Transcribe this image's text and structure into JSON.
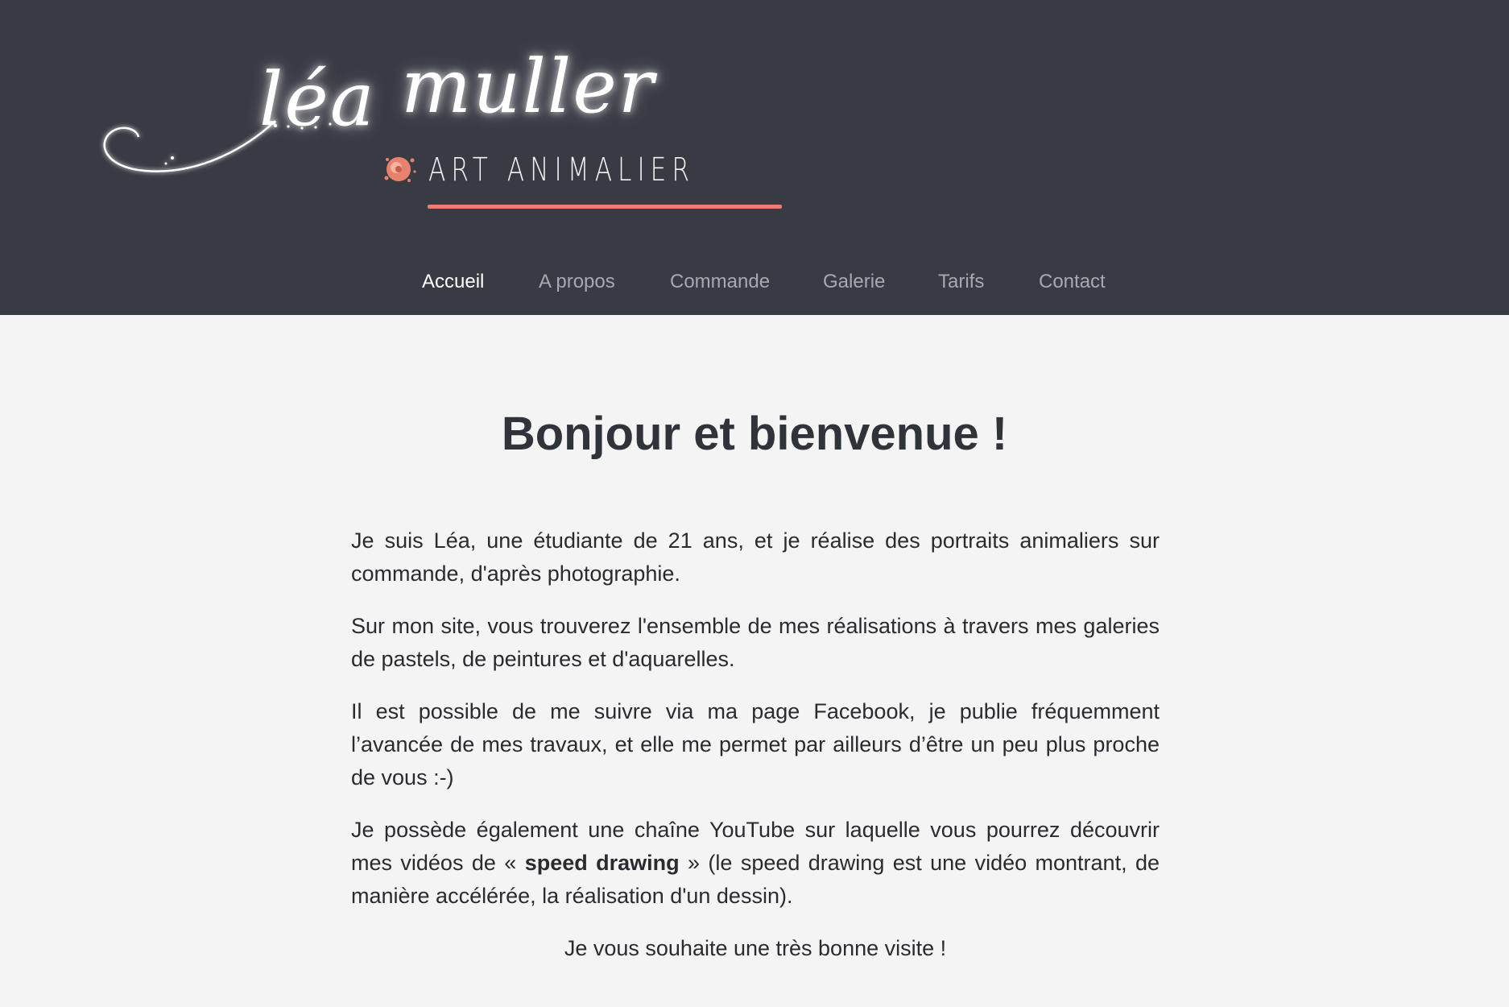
{
  "header": {
    "logo": {
      "first_name": "léa",
      "last_name": "muller",
      "subtitle": "ART ANIMALIER"
    },
    "nav": [
      {
        "label": "Accueil",
        "active": true
      },
      {
        "label": "A propos",
        "active": false
      },
      {
        "label": "Commande",
        "active": false
      },
      {
        "label": "Galerie",
        "active": false
      },
      {
        "label": "Tarifs",
        "active": false
      },
      {
        "label": "Contact",
        "active": false
      }
    ]
  },
  "main": {
    "title": "Bonjour et bienvenue !",
    "paragraphs": [
      "Je suis Léa, une étudiante de 21 ans, et je réalise des portraits animaliers sur commande, d'après photographie.",
      "Sur mon site, vous trouverez l'ensemble de mes réalisations à travers mes galeries de pastels, de peintures et d'aquarelles.",
      "Il est possible de me suivre via ma page Facebook, je publie fréquemment l’avancée de mes travaux, et elle me permet par ailleurs d’être un peu plus proche de vous :-)"
    ],
    "youtube_paragraph": {
      "before": "Je possède également une chaîne YouTube sur laquelle vous pourrez découvrir mes vidéos de « ",
      "bold": "speed drawing",
      "after": " » (le speed drawing est une vidéo montrant, de manière accélérée, la réalisation d'un dessin)."
    },
    "closing": "Je vous souhaite une très bonne visite !"
  },
  "colors": {
    "header_bg": "#393b44",
    "page_bg": "#f4f4f4",
    "accent": "#e8826f",
    "nav_inactive": "#a8a9ae",
    "nav_active": "#ffffff",
    "text": "#2a2b30"
  },
  "icons": {
    "logo_emblem": "paint-splash-icon",
    "logo_flourish": "swirl-flourish"
  }
}
